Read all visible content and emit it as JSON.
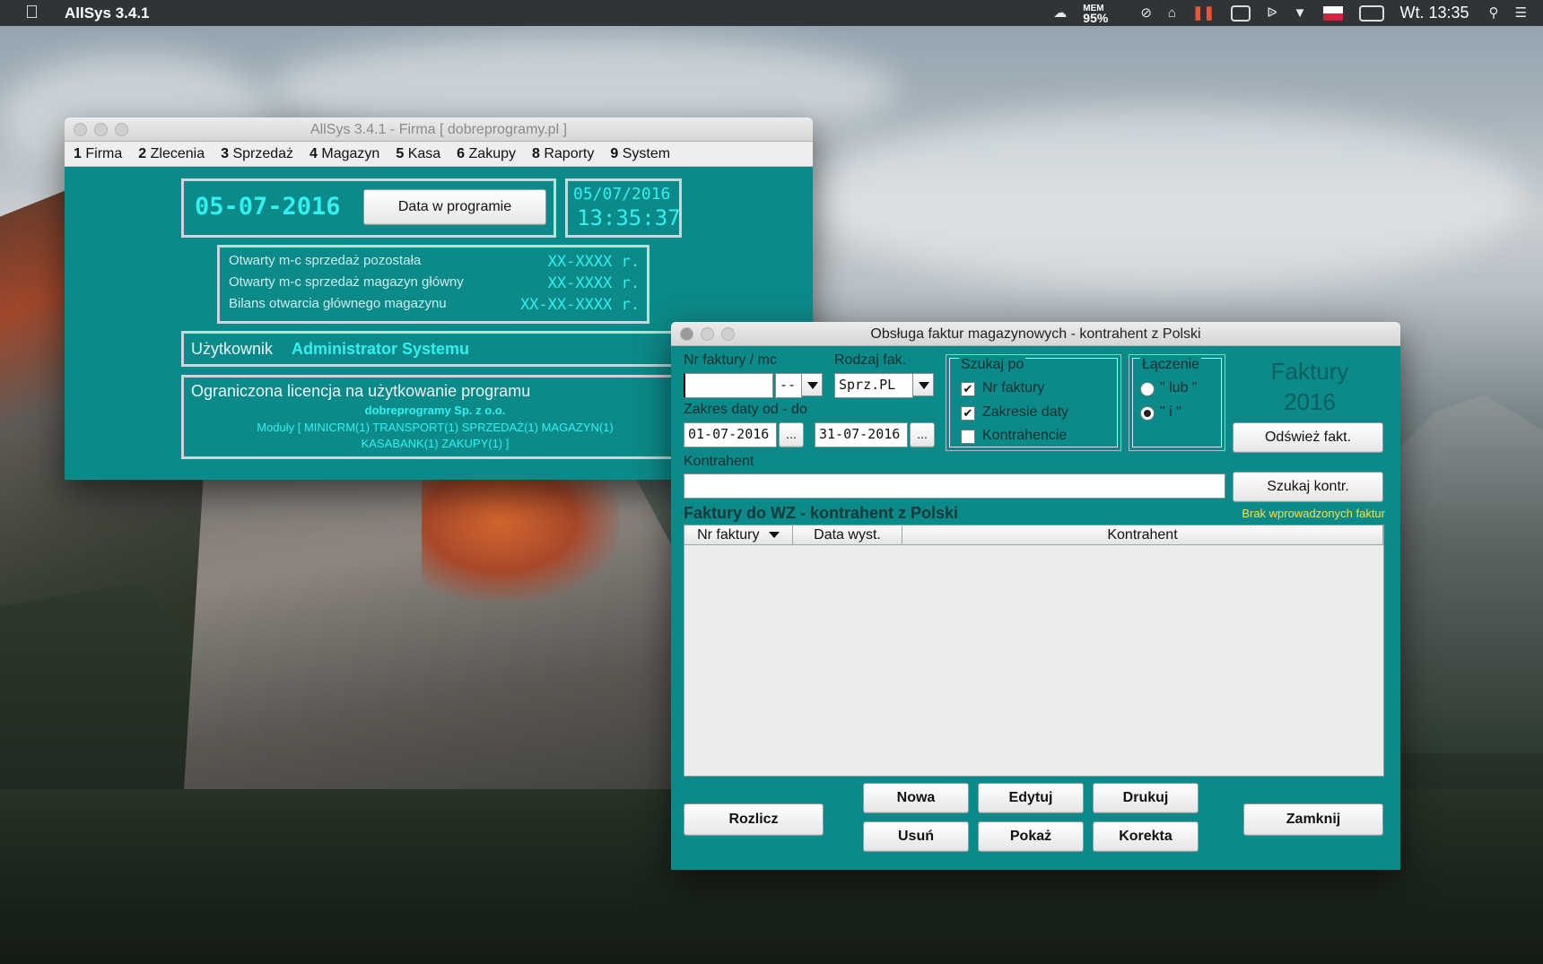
{
  "menubar": {
    "app_name": "AllSys 3.4.1",
    "mem_label": "MEM",
    "mem_value": "95%",
    "clock": "Wt. 13:35"
  },
  "main_window": {
    "title": "AllSys 3.4.1 - Firma [ dobreprogramy.pl ]",
    "menu": [
      {
        "num": "1",
        "label": "Firma"
      },
      {
        "num": "2",
        "label": "Zlecenia"
      },
      {
        "num": "3",
        "label": "Sprzedaż"
      },
      {
        "num": "4",
        "label": "Magazyn"
      },
      {
        "num": "5",
        "label": "Kasa"
      },
      {
        "num": "6",
        "label": "Zakupy"
      },
      {
        "num": "8",
        "label": "Raporty"
      },
      {
        "num": "9",
        "label": "System"
      }
    ],
    "program_date": "05-07-2016",
    "date_button": "Data w programie",
    "current_date": "05/07/2016",
    "current_time": "13:35:37",
    "status_rows": [
      {
        "label": "Otwarty m-c sprzedaż pozostała",
        "value": "XX-XXXX r."
      },
      {
        "label": "Otwarty m-c sprzedaż magazyn główny",
        "value": "XX-XXXX r."
      },
      {
        "label": "Bilans otwarcia głównego magazynu",
        "value": "XX-XX-XXXX r."
      }
    ],
    "user_label": "Użytkownik",
    "user_name": "Administrator Systemu",
    "license_title": "Ograniczona licencja na użytkowanie programu",
    "license_company": "dobreprogramy Sp. z o.o.",
    "license_modules_1": "Moduły [ MINICRM(1) TRANSPORT(1) SPRZEDAŻ(1) MAGAZYN(1)",
    "license_modules_2": "KASABANK(1) ZAKUPY(1) ]"
  },
  "invoice_window": {
    "title": "Obsługa faktur magazynowych - kontrahent z Polski",
    "nr_label": "Nr faktury  /  mc",
    "nr_value": "",
    "mc_value": "--",
    "rodzaj_label": "Rodzaj fak.",
    "rodzaj_value": "Sprz.PL",
    "date_range_label": "Zakres daty od - do",
    "date_from": "01-07-2016",
    "date_to": "31-07-2016",
    "ellipsis": "...",
    "search_group": {
      "title": "Szukaj po",
      "options": [
        {
          "label": "Nr faktury",
          "checked": true
        },
        {
          "label": "Zakresie daty",
          "checked": true
        },
        {
          "label": "Kontrahencie",
          "checked": false
        }
      ]
    },
    "join_group": {
      "title": "Łączenie",
      "options": [
        {
          "label": "\" lub \"",
          "selected": false
        },
        {
          "label": "\" i \"",
          "selected": true
        }
      ]
    },
    "year_title": "Faktury",
    "year_value": "2016",
    "refresh_button": "Odśwież fakt.",
    "kontrahent_label": "Kontrahent",
    "kontrahent_value": "",
    "search_contractor_button": "Szukaj kontr.",
    "table_title": "Faktury do WZ - kontrahent z Polski",
    "table_status": "Brak wprowadzonych faktur",
    "columns": [
      "Nr faktury",
      "Data wyst.",
      "Kontrahent"
    ],
    "buttons": {
      "rozlicz": "Rozlicz",
      "nowa": "Nowa",
      "edytuj": "Edytuj",
      "drukuj": "Drukuj",
      "usun": "Usuń",
      "pokaz": "Pokaż",
      "korekta": "Korekta",
      "zamknij": "Zamknij"
    },
    "colors": {
      "teal": "#0c8a89",
      "highlight_cyan": "#32f0f0",
      "status_yellow": "#f2e24a"
    }
  }
}
